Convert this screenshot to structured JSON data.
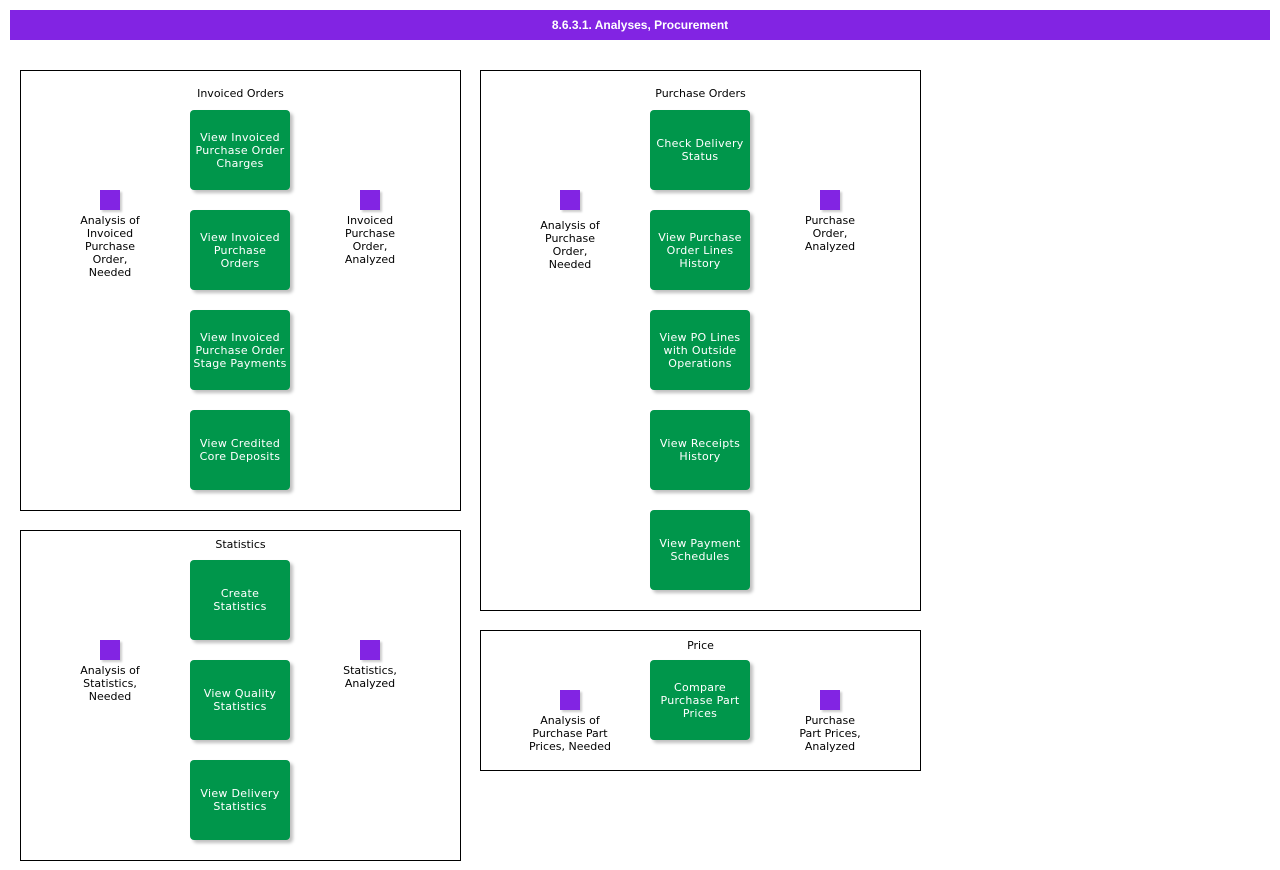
{
  "header": {
    "title": "8.6.3.1. Analyses, Procurement"
  },
  "colors": {
    "header": "#8224e3",
    "activity": "#00964b",
    "event": "#8224e3",
    "connector": "#808080"
  },
  "panels": {
    "invoiced_orders": {
      "title": "Invoiced Orders",
      "start_event": "Analysis of\nInvoiced\nPurchase\nOrder,\nNeeded",
      "end_event": "Invoiced\nPurchase\nOrder,\nAnalyzed",
      "activities": [
        "View Invoiced Purchase Order Charges",
        "View Invoiced Purchase Orders",
        "View Invoiced Purchase Order Stage Payments",
        "View Credited Core Deposits"
      ]
    },
    "purchase_orders": {
      "title": "Purchase Orders",
      "start_event": "Analysis of\nPurchase\nOrder,\nNeeded",
      "end_event": "Purchase\nOrder,\nAnalyzed",
      "activities": [
        "Check Delivery Status",
        "View Purchase Order Lines History",
        "View PO Lines with Outside Operations",
        "View Receipts History",
        "View Payment Schedules"
      ]
    },
    "statistics": {
      "title": "Statistics",
      "start_event": "Analysis of\nStatistics,\nNeeded",
      "end_event": "Statistics,\nAnalyzed",
      "activities": [
        "Create Statistics",
        "View Quality Statistics",
        "View Delivery Statistics"
      ]
    },
    "price": {
      "title": "Price",
      "start_event": "Analysis of\nPurchase Part\nPrices, Needed",
      "end_event": "Purchase\nPart Prices,\nAnalyzed",
      "activities": [
        "Compare Purchase Part Prices"
      ]
    }
  }
}
